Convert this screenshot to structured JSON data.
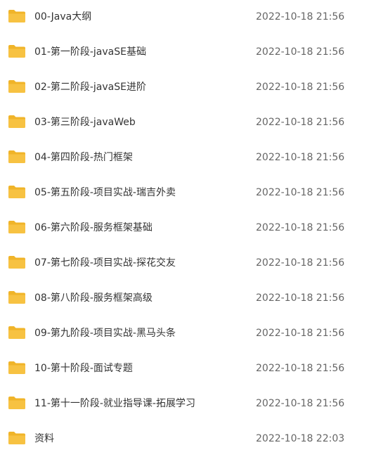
{
  "file_list": {
    "folder_color": "#f7c242",
    "folder_tab_color": "#f0b429",
    "items": [
      {
        "icon": "folder-icon",
        "name": "00-Java大纲",
        "modified": "2022-10-18 21:56"
      },
      {
        "icon": "folder-icon",
        "name": "01-第一阶段-javaSE基础",
        "modified": "2022-10-18 21:56"
      },
      {
        "icon": "folder-icon",
        "name": "02-第二阶段-javaSE进阶",
        "modified": "2022-10-18 21:56"
      },
      {
        "icon": "folder-icon",
        "name": "03-第三阶段-javaWeb",
        "modified": "2022-10-18 21:56"
      },
      {
        "icon": "folder-icon",
        "name": "04-第四阶段-热门框架",
        "modified": "2022-10-18 21:56"
      },
      {
        "icon": "folder-icon",
        "name": "05-第五阶段-项目实战-瑞吉外卖",
        "modified": "2022-10-18 21:56"
      },
      {
        "icon": "folder-icon",
        "name": "06-第六阶段-服务框架基础",
        "modified": "2022-10-18 21:56"
      },
      {
        "icon": "folder-icon",
        "name": "07-第七阶段-项目实战-探花交友",
        "modified": "2022-10-18 21:56"
      },
      {
        "icon": "folder-icon",
        "name": "08-第八阶段-服务框架高级",
        "modified": "2022-10-18 21:56"
      },
      {
        "icon": "folder-icon",
        "name": "09-第九阶段-项目实战-黑马头条",
        "modified": "2022-10-18 21:56"
      },
      {
        "icon": "folder-icon",
        "name": "10-第十阶段-面试专题",
        "modified": "2022-10-18 21:56"
      },
      {
        "icon": "folder-icon",
        "name": "11-第十一阶段-就业指导课-拓展学习",
        "modified": "2022-10-18 21:56"
      },
      {
        "icon": "folder-icon",
        "name": "资料",
        "modified": "2022-10-18 22:03"
      }
    ]
  }
}
